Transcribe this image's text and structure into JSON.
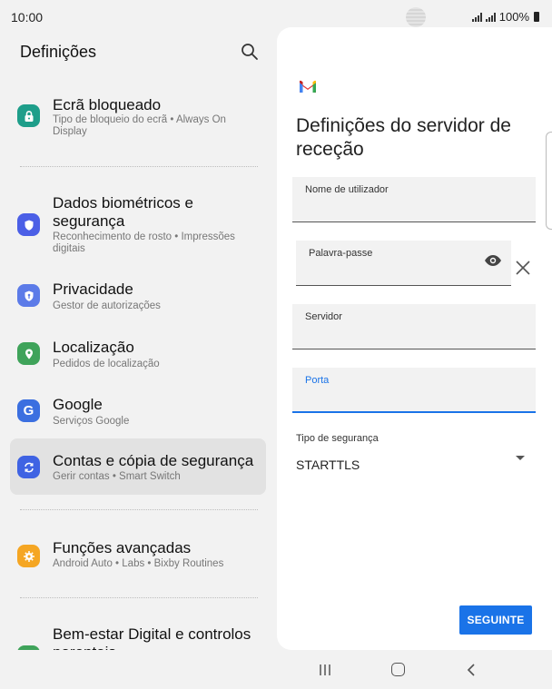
{
  "status": {
    "time": "10:00",
    "battery": "100%"
  },
  "settings": {
    "title": "Definições",
    "items": [
      {
        "title": "Ecrã bloqueado",
        "subtitle": "Tipo de bloqueio do ecrã  •  Always On Display",
        "color": "#1e9e8a",
        "icon": "lock-icon"
      },
      {
        "title": "Dados biométricos e segurança",
        "subtitle": "Reconhecimento de rosto  •  Impressões digitais",
        "color": "#4b5fe6",
        "icon": "shield-icon"
      },
      {
        "title": "Privacidade",
        "subtitle": "Gestor de autorizações",
        "color": "#5c7be8",
        "icon": "privacy-icon"
      },
      {
        "title": "Localização",
        "subtitle": "Pedidos de localização",
        "color": "#3fa35a",
        "icon": "location-pin-icon"
      },
      {
        "title": "Google",
        "subtitle": "Serviços Google",
        "color": "#3b6fe0",
        "icon": "google-icon"
      },
      {
        "title": "Contas e cópia de segurança",
        "subtitle": "Gerir contas  •  Smart Switch",
        "color": "#3f63e3",
        "icon": "sync-icon"
      },
      {
        "title": "Funções avançadas",
        "subtitle": "Android Auto  •  Labs  •  Bixby Routines",
        "color": "#f5a623",
        "icon": "gear-star-icon"
      },
      {
        "title": "Bem-estar Digital e controlos parentais",
        "subtitle": "",
        "color": "#3fa35a",
        "icon": "wellbeing-icon"
      }
    ]
  },
  "form": {
    "title": "Definições do servidor de receção",
    "username_label": "Nome de utilizador",
    "username_value": "",
    "password_label": "Palavra-passe",
    "password_value": "",
    "server_label": "Servidor",
    "server_value": "",
    "port_label": "Porta",
    "port_value": "",
    "security_label": "Tipo de segurança",
    "security_value": "STARTTLS",
    "next_button": "SEGUINTE",
    "accent": "#1a73e8"
  }
}
